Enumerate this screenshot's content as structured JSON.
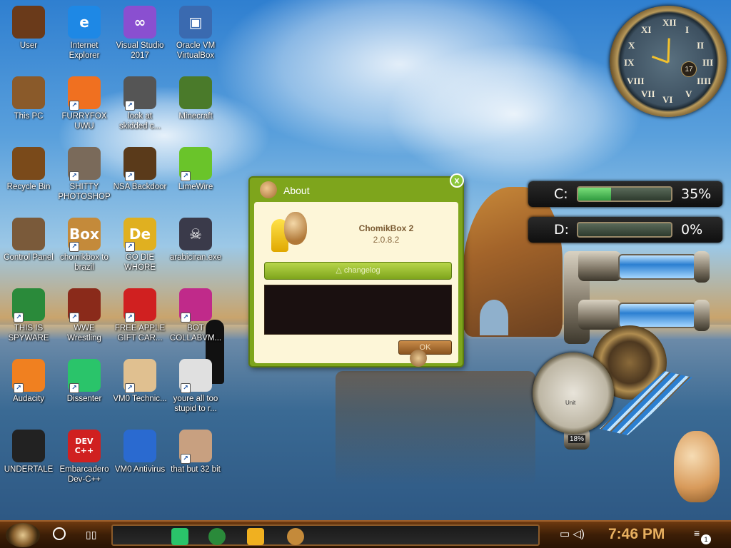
{
  "desktop": {
    "icons": [
      {
        "label": "User",
        "icon": "user-folder-icon",
        "color": "#6a3a1a",
        "glyph": "",
        "shortcut": false
      },
      {
        "label": "Internet Explorer",
        "icon": "edge-browser-icon",
        "color": "#1e88e5",
        "glyph": "e",
        "shortcut": false
      },
      {
        "label": "Visual Studio 2017",
        "icon": "visual-studio-icon",
        "color": "#8a4fd0",
        "glyph": "∞",
        "shortcut": false
      },
      {
        "label": "Oracle VM VirtualBox",
        "icon": "virtualbox-icon",
        "color": "#3a6ab0",
        "glyph": "▣",
        "shortcut": false
      },
      {
        "label": "This PC",
        "icon": "computer-icon",
        "color": "#8a5a2a",
        "glyph": "",
        "shortcut": false
      },
      {
        "label": "FURRYFOX UWU",
        "icon": "firefox-icon",
        "color": "#f07020",
        "glyph": "",
        "shortcut": true
      },
      {
        "label": "look at skidded c...",
        "icon": "window-stack-icon",
        "color": "#555555",
        "glyph": "",
        "shortcut": true
      },
      {
        "label": "Minecraft",
        "icon": "minecraft-block-icon",
        "color": "#4a7a2a",
        "glyph": "",
        "shortcut": false
      },
      {
        "label": "Recycle Bin",
        "icon": "recycle-bin-icon",
        "color": "#7a4a1a",
        "glyph": "",
        "shortcut": false
      },
      {
        "label": "SHITTY PHOTOSHOP",
        "icon": "gimp-icon",
        "color": "#7a6a5a",
        "glyph": "",
        "shortcut": true
      },
      {
        "label": "NSA Backdoor",
        "icon": "gramophone-icon",
        "color": "#5a3a1a",
        "glyph": "",
        "shortcut": true
      },
      {
        "label": "LimeWire",
        "icon": "limewire-icon",
        "color": "#6ac42a",
        "glyph": "",
        "shortcut": true
      },
      {
        "label": "Control Panel",
        "icon": "control-panel-icon",
        "color": "#7a5a3a",
        "glyph": "",
        "shortcut": false
      },
      {
        "label": "chomikbox to brazil",
        "icon": "chomikbox-icon",
        "color": "#c48a3a",
        "glyph": "Box",
        "shortcut": true
      },
      {
        "label": "GO DIE WHORE",
        "icon": "dimension-app-icon",
        "color": "#e0b020",
        "glyph": "De",
        "shortcut": true
      },
      {
        "label": "arabiciran.exe",
        "icon": "skull-icon",
        "color": "#3a3a4a",
        "glyph": "☠",
        "shortcut": false
      },
      {
        "label": "THIS IS SPYWARE",
        "icon": "chrome-icon",
        "color": "#2a8a3a",
        "glyph": "",
        "shortcut": true
      },
      {
        "label": "WWE Wrestling",
        "icon": "oven-icon",
        "color": "#8a2a1a",
        "glyph": "",
        "shortcut": true
      },
      {
        "label": "FREE APPLE GIFT CAR...",
        "icon": "apple-icon",
        "color": "#d02020",
        "glyph": "",
        "shortcut": true
      },
      {
        "label": "BOT COLLABVM...",
        "icon": "monitor-icon",
        "color": "#c02a8a",
        "glyph": "",
        "shortcut": true
      },
      {
        "label": "Audacity",
        "icon": "audacity-icon",
        "color": "#f08020",
        "glyph": "",
        "shortcut": true
      },
      {
        "label": "Dissenter",
        "icon": "dissenter-icon",
        "color": "#2ac46a",
        "glyph": "",
        "shortcut": true
      },
      {
        "label": "VM0 Technic...",
        "icon": "technician-icon",
        "color": "#e0c090",
        "glyph": "",
        "shortcut": true
      },
      {
        "label": "youre all too stupid to r...",
        "icon": "portrait-sketch-icon",
        "color": "#e0e0e0",
        "glyph": "",
        "shortcut": true
      },
      {
        "label": "UNDERTALE",
        "icon": "unity-icon",
        "color": "#222222",
        "glyph": "",
        "shortcut": false
      },
      {
        "label": "Embarcadero Dev-C++",
        "icon": "devcpp-icon",
        "color": "#d02020",
        "glyph": "DEV C++",
        "shortcut": false
      },
      {
        "label": "VM0 Antivirus",
        "icon": "shield-icon",
        "color": "#2a6ad0",
        "glyph": "",
        "shortcut": false
      },
      {
        "label": "that but 32 bit",
        "icon": "portrait-icon",
        "color": "#c8a080",
        "glyph": "",
        "shortcut": true
      }
    ]
  },
  "clock": {
    "numerals": [
      "XII",
      "I",
      "II",
      "III",
      "IIII",
      "V",
      "VI",
      "VII",
      "VIII",
      "IX",
      "X",
      "XI"
    ],
    "date": "17"
  },
  "disks": [
    {
      "letter": "C:",
      "percent_text": "35%",
      "fill": 0.35
    },
    {
      "letter": "D:",
      "percent_text": "0%",
      "fill": 0.0
    }
  ],
  "gauge_readout": "18%",
  "gauge_label": "Unit",
  "about_dialog": {
    "title": "About",
    "close_glyph": "x",
    "app_name": "ChomikBox 2",
    "version": "2.0.8.2",
    "changelog_button": "△ changelog",
    "ok_button": "OK"
  },
  "taskbar": {
    "time": "7:46 PM",
    "notification_count": "1",
    "pinned_apps": [
      {
        "name": "dissenter-taskbar-icon",
        "color": "#2ac46a"
      },
      {
        "name": "chrome-taskbar-icon",
        "color": "#2a8a3a"
      },
      {
        "name": "file-explorer-taskbar-icon",
        "color": "#f0b020"
      },
      {
        "name": "chomikbox-taskbar-icon",
        "color": "#c48a3a"
      }
    ]
  }
}
